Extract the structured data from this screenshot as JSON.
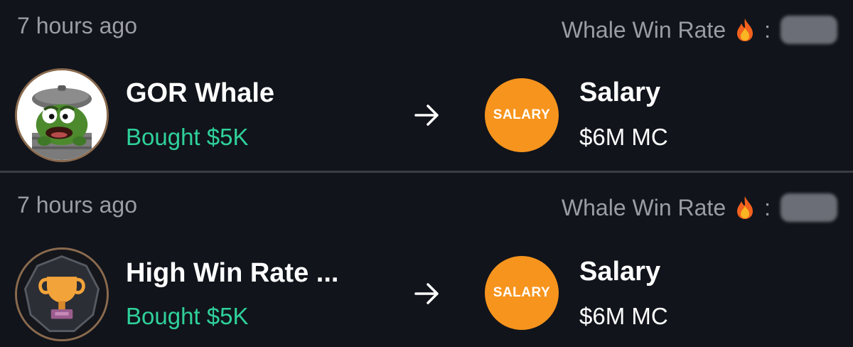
{
  "feed": {
    "items": [
      {
        "timestamp": "7 hours ago",
        "winrate_label": "Whale Win Rate",
        "winrate_separator": ":",
        "winrate_value": "",
        "trader": {
          "name": "GOR Whale",
          "avatar_icon": "oscar-grouch-avatar"
        },
        "action": "Bought $5K",
        "token": {
          "logo_text": "SALARY",
          "name": "Salary",
          "market_cap": "$6M MC"
        }
      },
      {
        "timestamp": "7 hours ago",
        "winrate_label": "Whale Win Rate",
        "winrate_separator": ":",
        "winrate_value": "",
        "trader": {
          "name": "High Win Rate ...",
          "avatar_icon": "trophy-icon"
        },
        "action": "Bought $5K",
        "token": {
          "logo_text": "SALARY",
          "name": "Salary",
          "market_cap": "$6M MC"
        }
      }
    ]
  },
  "colors": {
    "background": "#11141b",
    "muted_text": "#9b9da3",
    "buy_green": "#2fd19a",
    "token_orange": "#f7941d",
    "avatar_border": "#8a6a4e"
  }
}
